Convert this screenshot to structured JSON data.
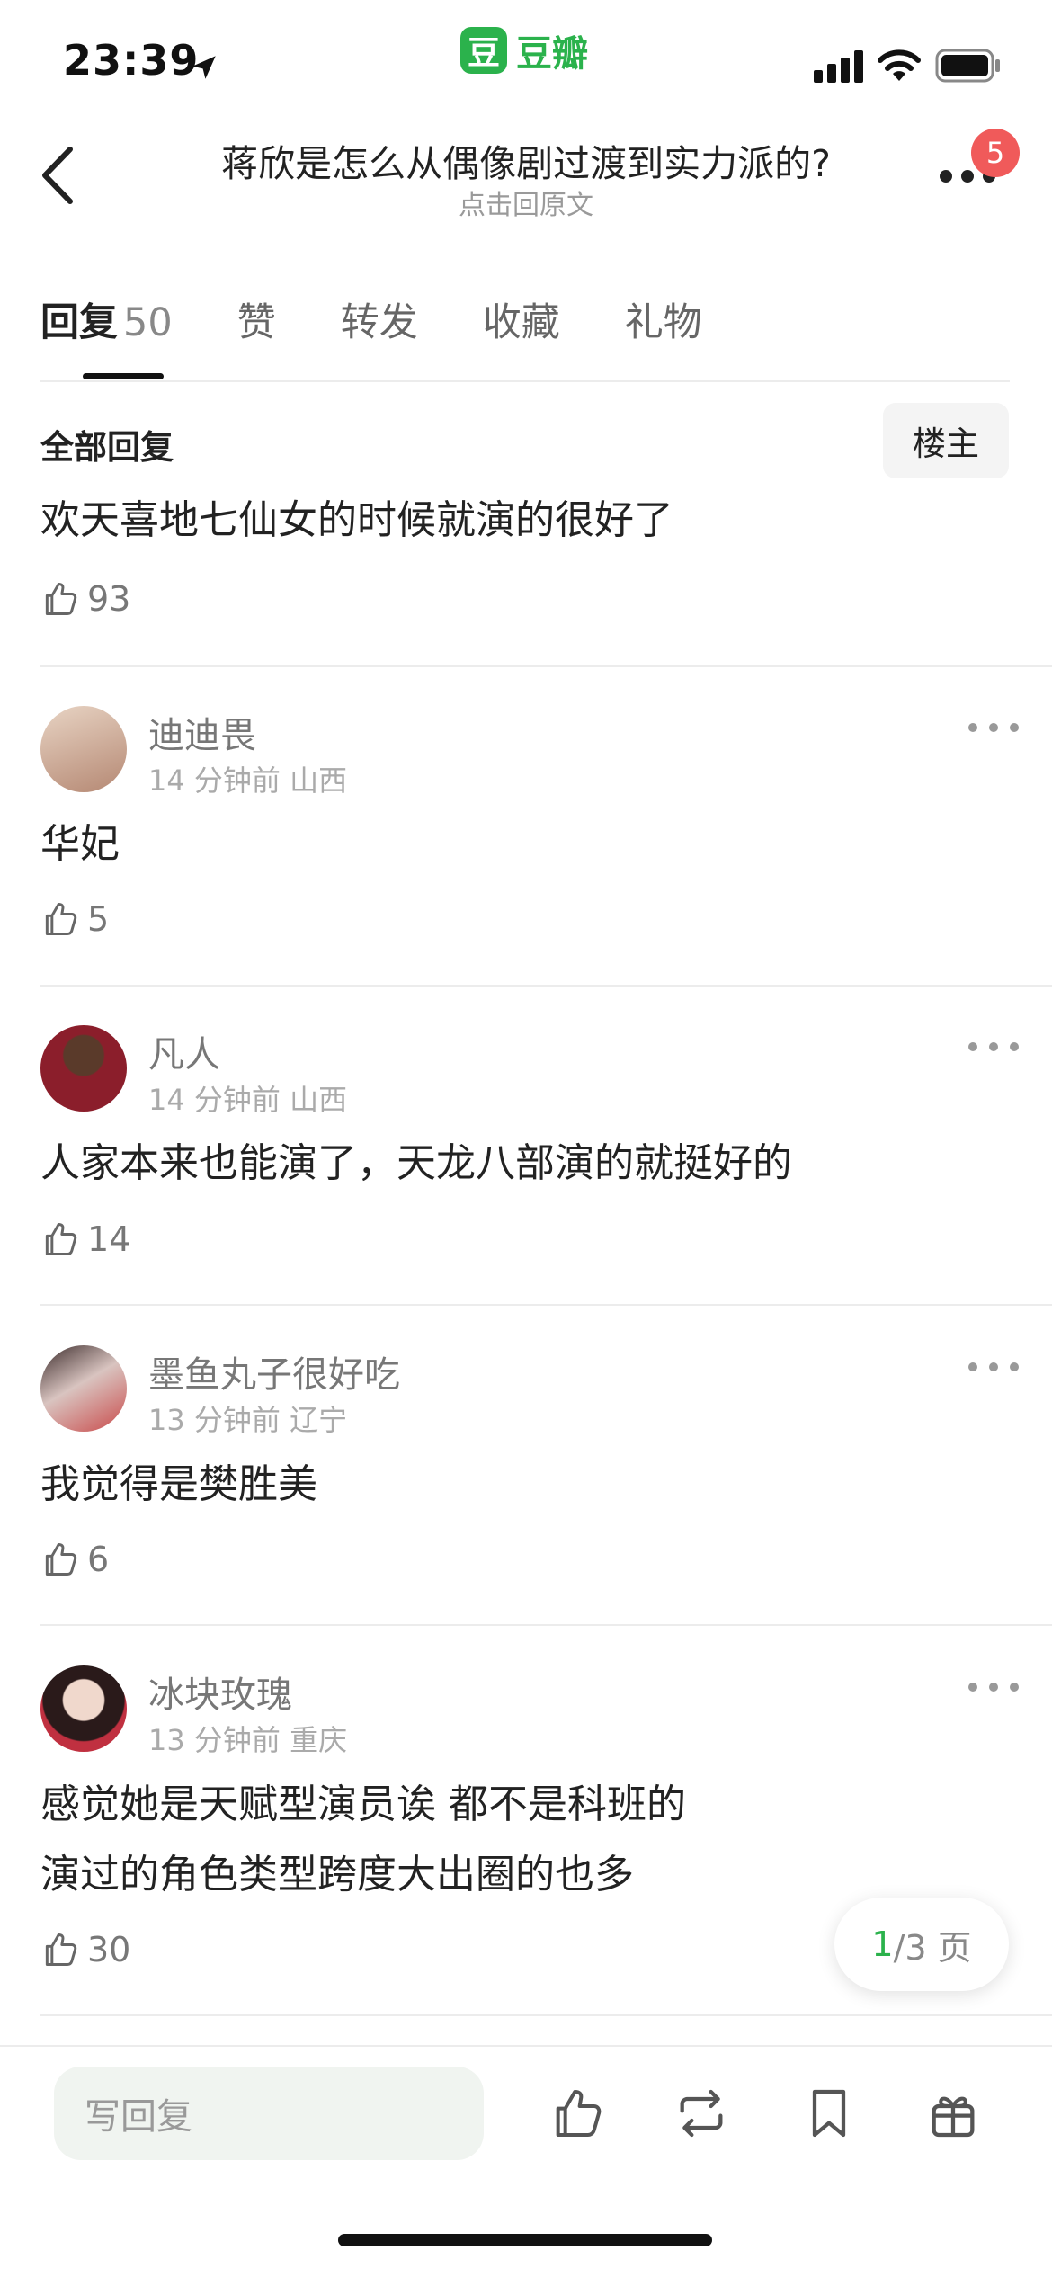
{
  "status": {
    "time": "23:39"
  },
  "app": {
    "logo_char": "豆",
    "name": "豆瓣"
  },
  "nav": {
    "title": "蒋欣是怎么从偶像剧过渡到实力派的?",
    "subtitle": "点击回原文",
    "badge": "5"
  },
  "tabs": [
    {
      "label": "回复",
      "count": "50"
    },
    {
      "label": "赞"
    },
    {
      "label": "转发"
    },
    {
      "label": "收藏"
    },
    {
      "label": "礼物"
    }
  ],
  "section": {
    "label": "全部回复",
    "op_button": "楼主"
  },
  "first_comment": {
    "text": "欢天喜地七仙女的时候就演的很好了",
    "likes": "93"
  },
  "comments": [
    {
      "username": "迪迪畏",
      "time": "14 分钟前",
      "region": "山西",
      "text": "华妃",
      "likes": "5",
      "avatar_color": "#c9a08a"
    },
    {
      "username": "凡人",
      "time": "14 分钟前",
      "region": "山西",
      "text": "人家本来也能演了，天龙八部演的就挺好的",
      "likes": "14",
      "avatar_color": "#6b2a2a"
    },
    {
      "username": "墨鱼丸子很好吃",
      "time": "13 分钟前",
      "region": "辽宁",
      "text": "我觉得是樊胜美",
      "likes": "6",
      "avatar_color": "#9a6a60"
    },
    {
      "username": "冰块玫瑰",
      "time": "13 分钟前",
      "region": "重庆",
      "text_line1": "感觉她是天赋型演员诶 都不是科班的",
      "text_line2": "演过的角色类型跨度大出圈的也多",
      "likes": "30",
      "avatar_color": "#d8b0a0"
    }
  ],
  "pager": {
    "current": "1",
    "total_text": "/3 页"
  },
  "bottom": {
    "reply_placeholder": "写回复"
  },
  "colors": {
    "accent": "#2bb24c",
    "badge": "#f05a5a"
  }
}
